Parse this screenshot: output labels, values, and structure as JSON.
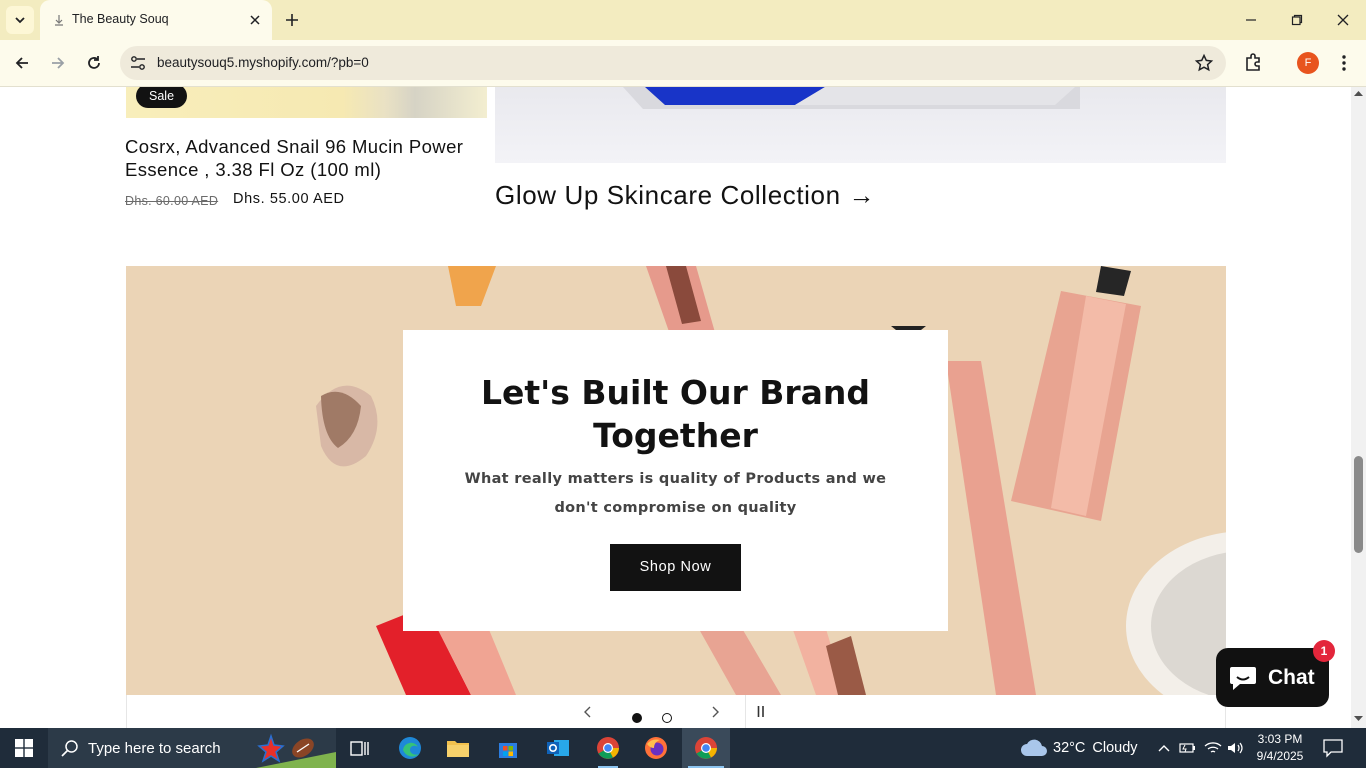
{
  "browser": {
    "tab_title": "The Beauty Souq",
    "url": "beautysouq5.myshopify.com/?pb=0",
    "profile_initial": "F"
  },
  "product": {
    "badge": "Sale",
    "title": "Cosrx, Advanced Snail 96 Mucin Power Essence , 3.38 Fl Oz (100 ml)",
    "price_old": "Dhs. 60.00 AED",
    "price_new": "Dhs. 55.00 AED"
  },
  "collection": {
    "link": "Glow Up Skincare Collection →"
  },
  "banner": {
    "headline": "Let's Built Our Brand Together",
    "subtext": "What really matters is quality of Products and we don't compromise on quality",
    "button": "Shop Now",
    "slide_count": 2,
    "active_slide": 1
  },
  "chat": {
    "label": "Chat",
    "badge": "1"
  },
  "taskbar": {
    "search_placeholder": "Type here to search",
    "weather_temp": "32°C",
    "weather_desc": "Cloudy",
    "time": "3:03 PM",
    "date": "9/4/2025"
  },
  "colors": {
    "banner_bg": "#ebd4b6",
    "button_dark": "#121212",
    "chat_badge": "#e3263b",
    "profile": "#e8541e"
  }
}
